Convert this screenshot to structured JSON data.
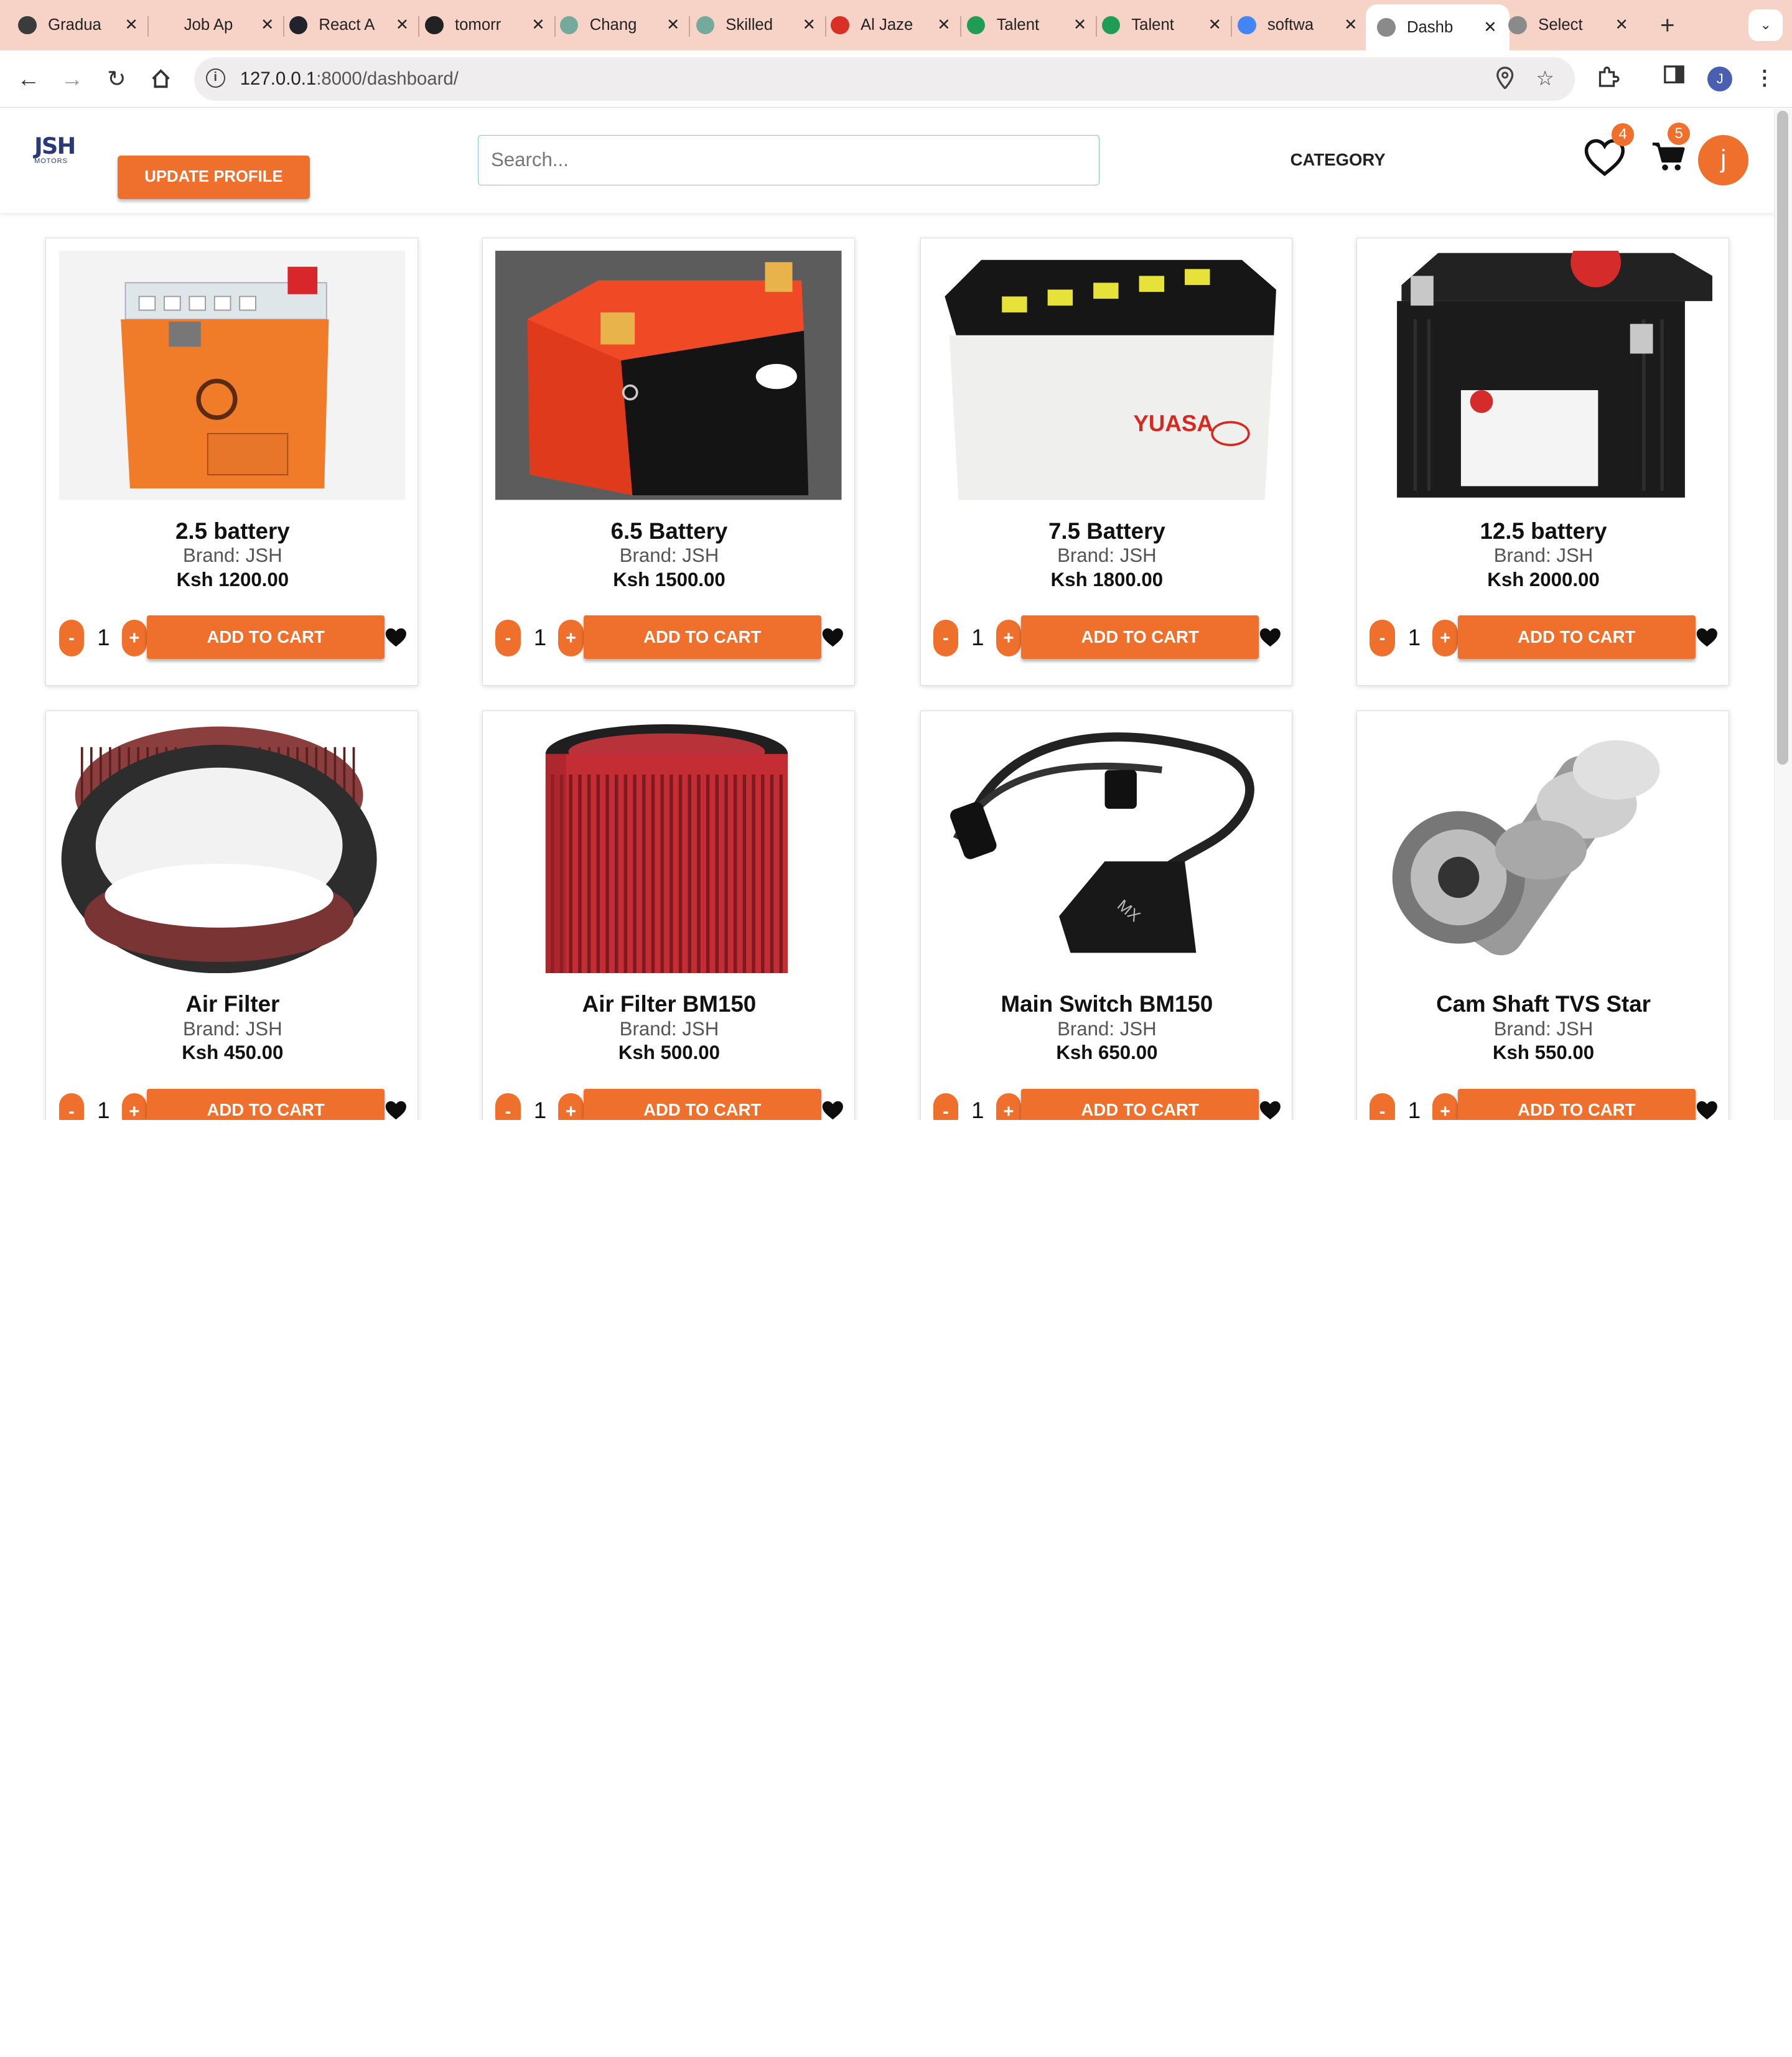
{
  "browser": {
    "tabs": [
      {
        "title": "Gradua",
        "icon": "info-icon",
        "color": "#3b3b3b"
      },
      {
        "title": "Job Ap",
        "icon": "blank-icon",
        "color": "#f6d3c6"
      },
      {
        "title": "React A",
        "icon": "react-icon",
        "color": "#20232a"
      },
      {
        "title": "tomorr",
        "icon": "github-icon",
        "color": "#222222"
      },
      {
        "title": "Chang",
        "icon": "chatgpt-icon",
        "color": "#74aa9c"
      },
      {
        "title": "Skilled",
        "icon": "chatgpt-icon",
        "color": "#74aa9c"
      },
      {
        "title": "Al Jaze",
        "icon": "gmail-icon",
        "color": "#d93025"
      },
      {
        "title": "Talent",
        "icon": "talent-icon",
        "color": "#1f9d55"
      },
      {
        "title": "Talent",
        "icon": "talent-icon",
        "color": "#1f9d55"
      },
      {
        "title": "softwa",
        "icon": "google-icon",
        "color": "#4285f4"
      },
      {
        "title": "Dashb",
        "icon": "globe-icon",
        "color": "#8a8a8a",
        "active": true
      },
      {
        "title": "Select",
        "icon": "globe-icon",
        "color": "#8a8a8a"
      }
    ],
    "new_tab": "+",
    "url_host": "127.0.0.1",
    "url_path": ":8000/dashboard/",
    "profile_initial": "J"
  },
  "header": {
    "logo_text": "JSH",
    "logo_sub": "MOTORS",
    "update_profile": "UPDATE PROFILE",
    "search_placeholder": "Search...",
    "category": "CATEGORY",
    "wishlist_count": "4",
    "cart_count": "5",
    "avatar_initial": "j"
  },
  "products": [
    {
      "name": "2.5 battery",
      "brand": "Brand: JSH",
      "price": "Ksh 1200.00",
      "qty": "1",
      "image": "battery-orange"
    },
    {
      "name": "6.5 Battery",
      "brand": "Brand: JSH",
      "price": "Ksh 1500.00",
      "qty": "1",
      "image": "battery-lithium"
    },
    {
      "name": "7.5 Battery",
      "brand": "Brand: JSH",
      "price": "Ksh 1800.00",
      "qty": "1",
      "image": "battery-yuasa"
    },
    {
      "name": "12.5 battery",
      "brand": "Brand: JSH",
      "price": "Ksh 2000.00",
      "qty": "1",
      "image": "battery-shorai"
    },
    {
      "name": "Air Filter",
      "brand": "Brand: JSH",
      "price": "Ksh 450.00",
      "qty": "1",
      "image": "air-filter-ring"
    },
    {
      "name": "Air Filter BM150",
      "brand": "Brand: JSH",
      "price": "Ksh 500.00",
      "qty": "1",
      "image": "air-filter-cylinder"
    },
    {
      "name": "Main Switch BM150",
      "brand": "Brand: JSH",
      "price": "Ksh 650.00",
      "qty": "1",
      "image": "ignition-coil"
    },
    {
      "name": "Cam Shaft TVS Star",
      "brand": "Brand: JSH",
      "price": "Ksh 550.00",
      "qty": "1",
      "image": "cam-shaft"
    }
  ],
  "labels": {
    "add_to_cart": "ADD TO CART",
    "minus": "-",
    "plus": "+"
  },
  "colors": {
    "accent": "#ef6f2c",
    "tab_strip": "#f6d3c6",
    "logo": "#2b3a74"
  }
}
